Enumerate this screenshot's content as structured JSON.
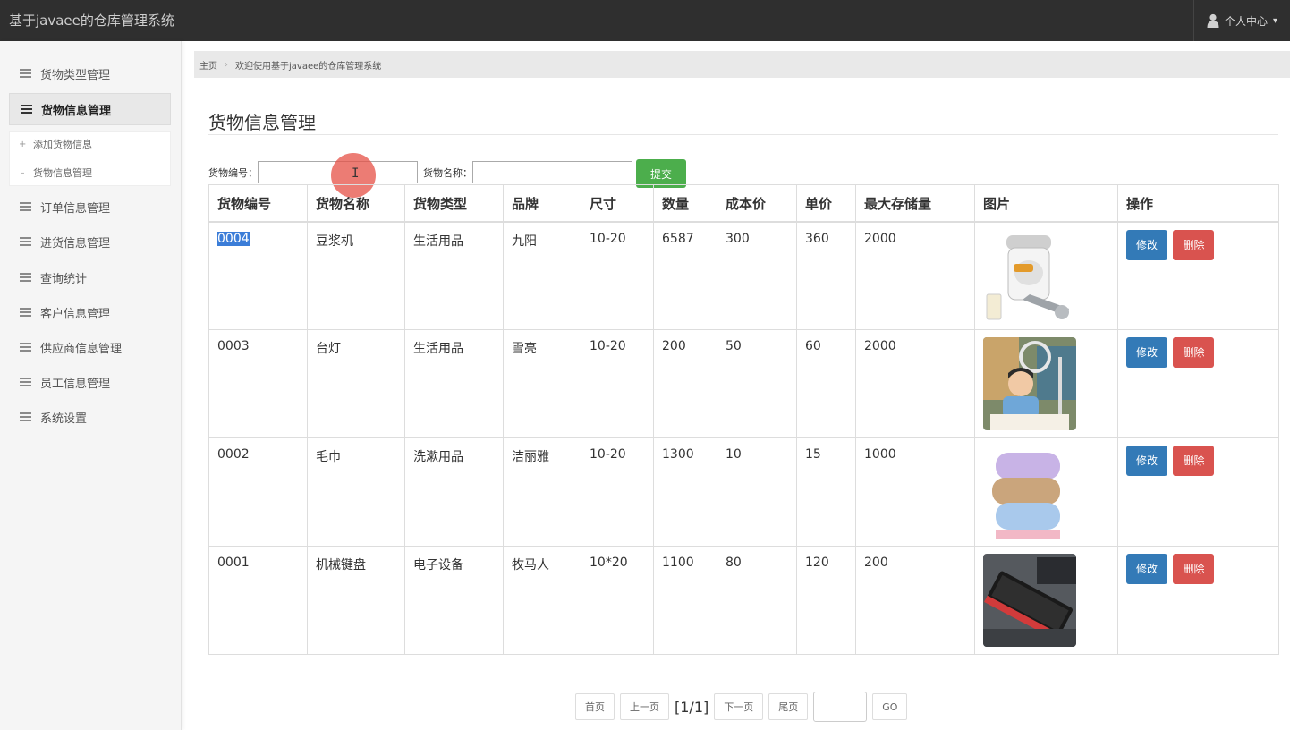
{
  "app": {
    "title": "基于javaee的仓库管理系统",
    "user_menu": "个人中心"
  },
  "sidebar": {
    "items": [
      {
        "label": "货物类型管理"
      },
      {
        "label": "货物信息管理"
      },
      {
        "label": "订单信息管理"
      },
      {
        "label": "进货信息管理"
      },
      {
        "label": "查询统计"
      },
      {
        "label": "客户信息管理"
      },
      {
        "label": "供应商信息管理"
      },
      {
        "label": "员工信息管理"
      },
      {
        "label": "系统设置"
      }
    ],
    "submenu": [
      {
        "marker": "+",
        "label": "添加货物信息"
      },
      {
        "marker": "–",
        "label": "货物信息管理"
      }
    ]
  },
  "breadcrumb": {
    "home": "主页",
    "current": "欢迎使用基于javaee的仓库管理系统"
  },
  "page": {
    "title": "货物信息管理"
  },
  "search": {
    "code_label": "货物编号：",
    "name_label": "货物名称：",
    "code_value": "",
    "name_value": "",
    "submit_label": "提交"
  },
  "table": {
    "headers": [
      "货物编号",
      "货物名称",
      "货物类型",
      "品牌",
      "尺寸",
      "数量",
      "成本价",
      "单价",
      "最大存储量",
      "图片",
      "操作"
    ],
    "rows": [
      {
        "code": "0004",
        "name": "豆浆机",
        "type": "生活用品",
        "brand": "九阳",
        "size": "10-20",
        "qty": "6587",
        "cost": "300",
        "price": "360",
        "max": "2000",
        "image": "soymilk-maker-photo"
      },
      {
        "code": "0003",
        "name": "台灯",
        "type": "生活用品",
        "brand": "雪亮",
        "size": "10-20",
        "qty": "200",
        "cost": "50",
        "price": "60",
        "max": "2000",
        "image": "desk-lamp-photo"
      },
      {
        "code": "0002",
        "name": "毛巾",
        "type": "洗漱用品",
        "brand": "洁丽雅",
        "size": "10-20",
        "qty": "1300",
        "cost": "10",
        "price": "15",
        "max": "1000",
        "image": "towels-photo"
      },
      {
        "code": "0001",
        "name": "机械键盘",
        "type": "电子设备",
        "brand": "牧马人",
        "size": "10*20",
        "qty": "1100",
        "cost": "80",
        "price": "120",
        "max": "200",
        "image": "keyboard-photo"
      }
    ],
    "edit_label": "修改",
    "delete_label": "删除"
  },
  "pagination": {
    "first": "首页",
    "prev": "上一页",
    "info": "[1/1]",
    "next": "下一页",
    "last": "尾页",
    "page_value": "",
    "go": "GO"
  },
  "colors": {
    "topbar": "#2f2f2f",
    "submit": "#4cae4c",
    "edit": "#337ab7",
    "delete": "#d9534f",
    "selection": "#3b7dd8"
  }
}
